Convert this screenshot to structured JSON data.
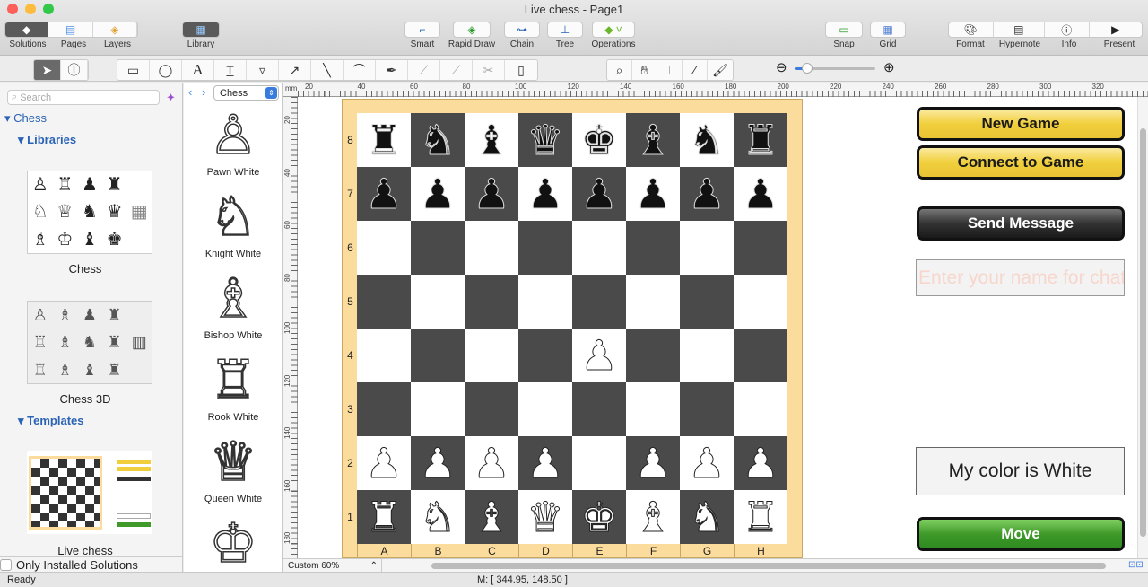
{
  "window": {
    "title": "Live chess - Page1"
  },
  "toolbar": {
    "left": [
      {
        "label": "Solutions",
        "icon": "solutions-icon"
      },
      {
        "label": "Pages",
        "icon": "pages-icon"
      },
      {
        "label": "Layers",
        "icon": "layers-icon"
      }
    ],
    "library": "Library",
    "center": [
      {
        "label": "Smart"
      },
      {
        "label": "Rapid Draw"
      },
      {
        "label": "Chain"
      },
      {
        "label": "Tree"
      },
      {
        "label": "Operations"
      }
    ],
    "snap": "Snap",
    "grid": "Grid",
    "right": [
      {
        "label": "Format"
      },
      {
        "label": "Hypernote"
      },
      {
        "label": "Info"
      },
      {
        "label": "Present"
      }
    ]
  },
  "sidebar": {
    "search_placeholder": "Search",
    "root": "Chess",
    "libraries": "Libraries",
    "templates": "Templates",
    "items": [
      {
        "label": "Chess"
      },
      {
        "label": "Chess 3D"
      },
      {
        "label": "Live chess"
      }
    ],
    "only_installed": "Only Installed Solutions"
  },
  "library": {
    "selected": "Chess",
    "items": [
      {
        "label": "Pawn White",
        "glyph": "♙"
      },
      {
        "label": "Knight White",
        "glyph": "♘"
      },
      {
        "label": "Bishop White",
        "glyph": "♗"
      },
      {
        "label": "Rook White",
        "glyph": "♖"
      },
      {
        "label": "Queen White",
        "glyph": "♕"
      },
      {
        "label": "",
        "glyph": "♔"
      }
    ]
  },
  "ruler": {
    "unit": "mm",
    "top": [
      "20",
      "40",
      "60",
      "80",
      "100",
      "120",
      "140",
      "160",
      "180",
      "200",
      "220",
      "240",
      "260",
      "280",
      "300",
      "320"
    ],
    "left": [
      "20",
      "40",
      "60",
      "80",
      "100",
      "120",
      "140",
      "160",
      "180"
    ]
  },
  "board": {
    "files": [
      "A",
      "B",
      "C",
      "D",
      "E",
      "F",
      "G",
      "H"
    ],
    "ranks": [
      "8",
      "7",
      "6",
      "5",
      "4",
      "3",
      "2",
      "1"
    ],
    "rows": [
      "rnbqkbnr",
      "pppppppp",
      "........",
      "........",
      "....P...",
      "........",
      "PPPP.PPP",
      "RNBQKBNR"
    ],
    "light": "#ffffff",
    "dark": "#4a4a4a"
  },
  "panel": {
    "new_game": "New Game",
    "connect": "Connect to Game",
    "send": "Send Message",
    "name_placeholder": "Enter your name for chat",
    "my_color": "My color is White",
    "move": "Move"
  },
  "zoom": {
    "label": "Custom 60%",
    "level": 0.15
  },
  "status": {
    "text": "Ready",
    "mouse": "M: [ 344.95, 148.50 ]"
  }
}
